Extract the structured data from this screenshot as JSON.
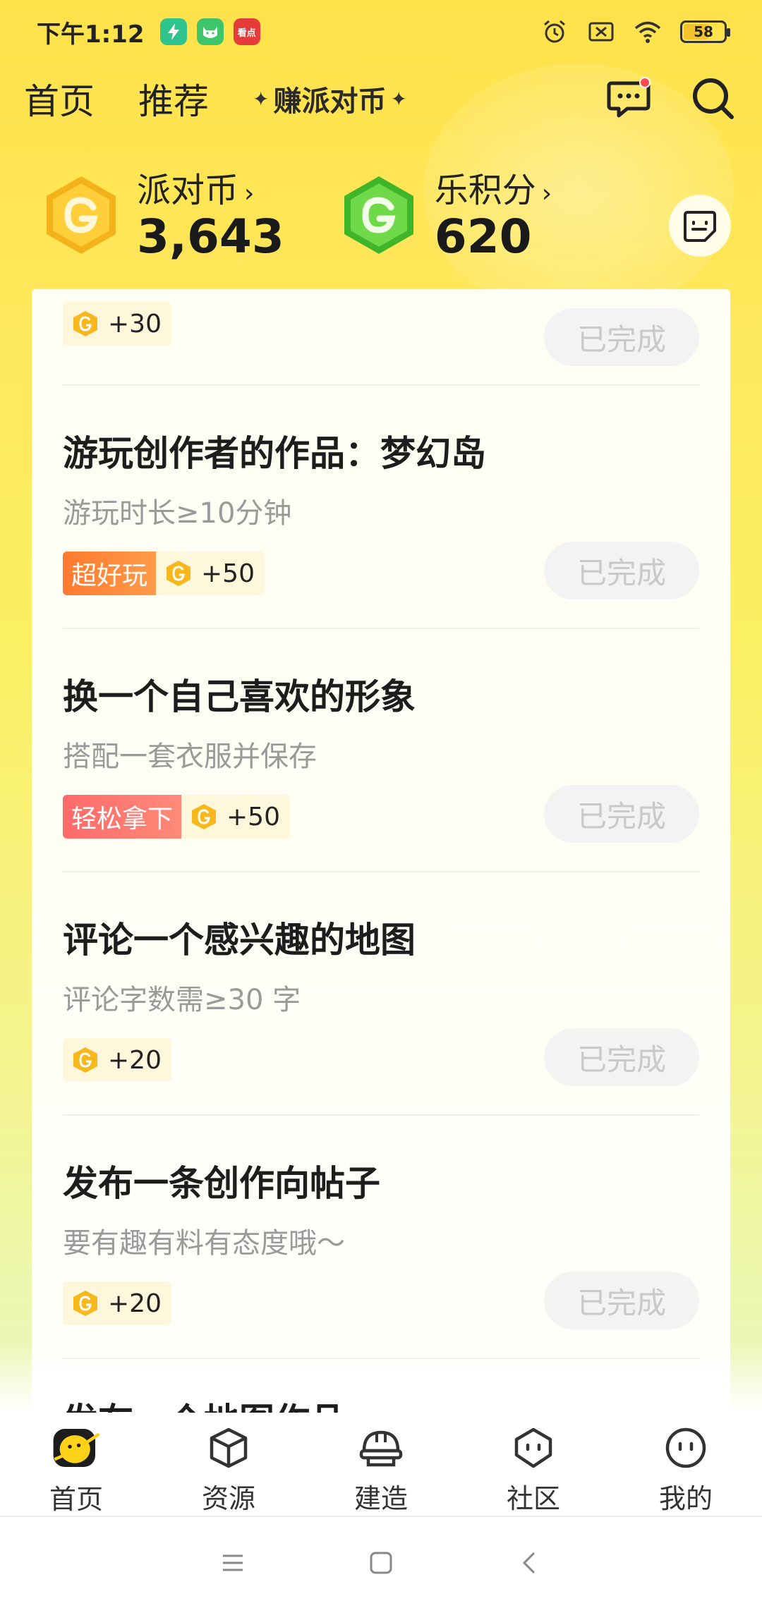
{
  "status_bar": {
    "time": "下午1:12",
    "apps": [
      {
        "name": "power-app-icon",
        "color": "#2fc48d",
        "glyph": "⚡"
      },
      {
        "name": "cat-app-icon",
        "color": "#3ec46b",
        "glyph": "ᵔᴥᵔ"
      },
      {
        "name": "news-app-icon",
        "color": "#e63b3b",
        "glyph": "看点"
      }
    ],
    "battery": "58"
  },
  "top_nav": {
    "tabs": [
      "首页",
      "推荐"
    ],
    "earn_label": "赚派对币"
  },
  "balances": [
    {
      "label": "派对币",
      "value": "3,643",
      "coin_color": "#f6b81c"
    },
    {
      "label": "乐积分",
      "value": "620",
      "coin_color": "#5ed03a"
    }
  ],
  "tasks": {
    "top_partial": {
      "reward": "+30",
      "status": "已完成"
    },
    "items": [
      {
        "title": "游玩创作者的作品：梦幻岛",
        "subtitle": "游玩时长≥10分钟",
        "tag": "超好玩",
        "tag_style": "orange",
        "reward": "+50",
        "status": "已完成"
      },
      {
        "title": "换一个自己喜欢的形象",
        "subtitle": "搭配一套衣服并保存",
        "tag": "轻松拿下",
        "tag_style": "pink",
        "reward": "+50",
        "status": "已完成"
      },
      {
        "title": "评论一个感兴趣的地图",
        "subtitle": "评论字数需≥30 字",
        "tag": "",
        "reward": "+20",
        "status": "已完成"
      },
      {
        "title": "发布一条创作向帖子",
        "subtitle": "要有趣有料有态度哦～",
        "tag": "",
        "reward": "+20",
        "status": "已完成"
      }
    ],
    "bottom_partial_title": "发布一个地图作品"
  },
  "bottom_nav": {
    "items": [
      {
        "label": "首页",
        "icon": "home-planet-icon"
      },
      {
        "label": "资源",
        "icon": "cube-icon"
      },
      {
        "label": "建造",
        "icon": "helmet-icon"
      },
      {
        "label": "社区",
        "icon": "community-icon"
      },
      {
        "label": "我的",
        "icon": "profile-icon"
      }
    ]
  }
}
